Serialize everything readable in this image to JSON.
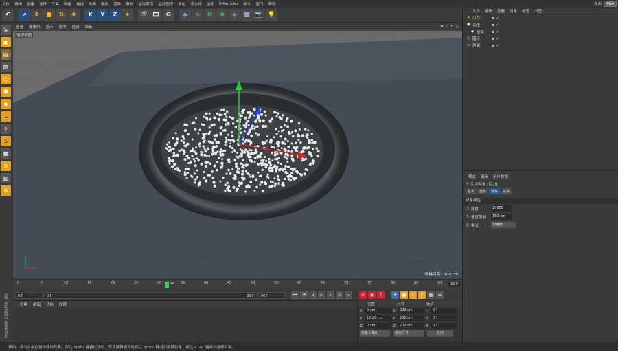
{
  "menu": [
    "文件",
    "编辑",
    "创建",
    "选择",
    "工具",
    "网格",
    "捕捉",
    "动画",
    "模拟",
    "渲染",
    "雕刻",
    "运动跟踪",
    "运动图形",
    "角色",
    "流水线",
    "插件",
    "X-Particles",
    "脚本",
    "窗口",
    "帮助"
  ],
  "layout": {
    "label": "界面",
    "value": "启动"
  },
  "viewport_menu": [
    "查看",
    "摄像机",
    "显示",
    "选项",
    "过滤",
    "面板"
  ],
  "viewport": {
    "label": "透视视图",
    "grid_spacing": "网格间距 : 100 cm"
  },
  "timeline": {
    "ticks": [
      "0",
      "5",
      "10",
      "15",
      "20",
      "25",
      "30",
      "35",
      "40",
      "45",
      "50",
      "55",
      "60",
      "65",
      "70",
      "75",
      "80",
      "85",
      "90"
    ],
    "current_frame": "32",
    "end_field": "32 F",
    "current_fraction": 0.356
  },
  "transport": {
    "start": "0 F",
    "slider_start": "0 F",
    "slider_end": "90 F",
    "end": "90 F"
  },
  "lower_tabs": [
    "创建",
    "编辑",
    "功能",
    "纹理"
  ],
  "coords": {
    "headers": [
      "位置",
      "尺寸",
      "旋转"
    ],
    "rows": [
      {
        "axis": "X",
        "pos": "0 cm",
        "size_axis": "X",
        "size": "200 cm",
        "rot_axis": "H",
        "rot": "0 °"
      },
      {
        "axis": "Y",
        "pos": "12.26 cm",
        "size_axis": "Y",
        "size": "200 cm",
        "rot_axis": "P",
        "rot": "0 °"
      },
      {
        "axis": "Z",
        "pos": "0 cm",
        "size_axis": "Z",
        "size": "200 cm",
        "rot_axis": "B",
        "rot": "0 °"
      }
    ],
    "mode1": "对象 (相对)",
    "mode2": "绝对尺寸",
    "apply": "应用"
  },
  "status": "移动：点击并拖动鼠标移动元素。按住 SHIFT 键量化移动；节点编辑模式时按住 SHIFT 键增加选择对象；按住 CTRL 键减少选择对象。",
  "object_manager": {
    "tabs": [
      "文件",
      "编辑",
      "查看",
      "对象",
      "标签",
      "书签"
    ],
    "objects": [
      {
        "name": "引力",
        "color": "#e8c84a",
        "indent": 0
      },
      {
        "name": "克隆",
        "color": "#ddd",
        "indent": 0
      },
      {
        "name": "宝石",
        "color": "#ddd",
        "indent": 1
      },
      {
        "name": "圆环",
        "color": "#ddd",
        "indent": 0
      },
      {
        "name": "地面",
        "color": "#ddd",
        "indent": 0
      }
    ]
  },
  "attributes": {
    "tabs": [
      "模式",
      "编辑",
      "用户数据"
    ],
    "title": "引力对象 [引力]",
    "subtabs": [
      "基本",
      "坐标",
      "对象",
      "衰减"
    ],
    "active_subtab": "对象",
    "section": "对象属性",
    "fields": [
      {
        "key": "强度",
        "value": "20000",
        "type": "num"
      },
      {
        "key": "速度限制",
        "value": "150 cm",
        "type": "num"
      },
      {
        "key": "模式 . . .",
        "value": "加速度",
        "type": "drop"
      }
    ]
  },
  "colors": {
    "accent": "#2a5a8c",
    "timeline_cursor": "#3ecf5a",
    "selected_tool": "#2a4f78"
  }
}
